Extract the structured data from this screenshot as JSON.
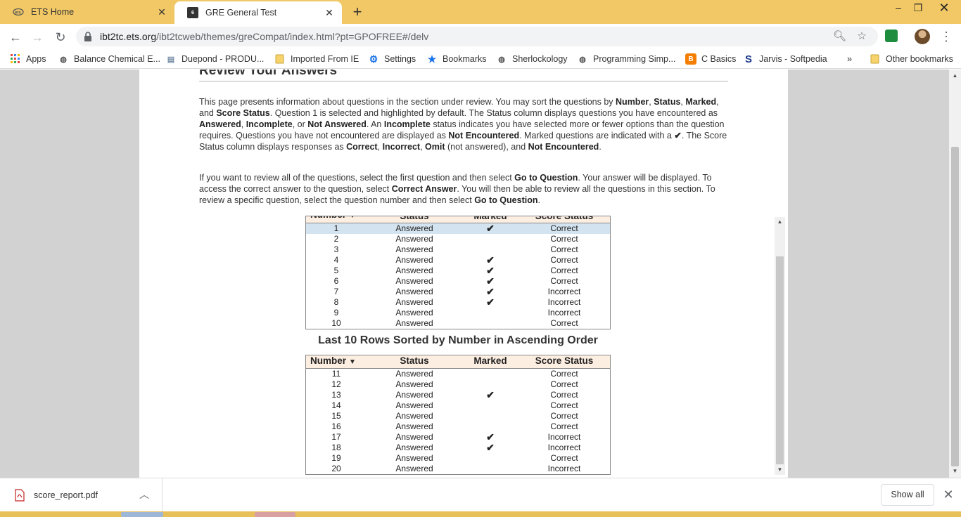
{
  "tabs": [
    {
      "title": "ETS Home",
      "active": false
    },
    {
      "title": "GRE General Test",
      "active": true
    }
  ],
  "address": {
    "url_host": "ibt2tc.ets.org",
    "url_path": "/ibt2tcweb/themes/greCompat/index.html?pt=GPOFREE#/delv"
  },
  "bookmarks": [
    {
      "label": "Apps"
    },
    {
      "label": "Balance Chemical E..."
    },
    {
      "label": "Duepond - PRODU..."
    },
    {
      "label": "Imported From IE"
    },
    {
      "label": "Settings"
    },
    {
      "label": "Bookmarks"
    },
    {
      "label": "Sherlockology"
    },
    {
      "label": "Programming Simp..."
    },
    {
      "label": "C Basics"
    },
    {
      "label": "Jarvis - Softpedia"
    },
    {
      "label": "»"
    },
    {
      "label": "Other bookmarks"
    }
  ],
  "page": {
    "section_title": "Review Your Answers",
    "para1": [
      {
        "t": "This page presents information about questions in the section under review. You may sort the questions by "
      },
      {
        "t": "Number",
        "b": true
      },
      {
        "t": ", "
      },
      {
        "t": "Status",
        "b": true
      },
      {
        "t": ", "
      },
      {
        "t": "Marked",
        "b": true
      },
      {
        "t": ", and "
      },
      {
        "t": "Score Status",
        "b": true
      },
      {
        "t": ". Question 1 is selected and highlighted by default. The Status column displays questions you have encountered as "
      },
      {
        "t": "Answered",
        "b": true
      },
      {
        "t": ", "
      },
      {
        "t": "Incomplete",
        "b": true
      },
      {
        "t": ", or "
      },
      {
        "t": "Not Answered",
        "b": true
      },
      {
        "t": ". An "
      },
      {
        "t": "Incomplete",
        "b": true
      },
      {
        "t": " status indicates you have selected more or fewer options than the question requires. Questions you have not encountered are displayed as "
      },
      {
        "t": "Not Encountered",
        "b": true
      },
      {
        "t": ". Marked questions are indicated with a "
      },
      {
        "t": "✔",
        "b": true
      },
      {
        "t": ". The Score Status column displays responses as "
      },
      {
        "t": "Correct",
        "b": true
      },
      {
        "t": ", "
      },
      {
        "t": "Incorrect",
        "b": true
      },
      {
        "t": ", "
      },
      {
        "t": "Omit",
        "b": true
      },
      {
        "t": " (not answered), and "
      },
      {
        "t": "Not Encountered",
        "b": true
      },
      {
        "t": "."
      }
    ],
    "para2": [
      {
        "t": "If you want to review all of the questions, select the first question and then select "
      },
      {
        "t": "Go to Question",
        "b": true
      },
      {
        "t": ". Your answer will be displayed. To access the correct answer to the question, select "
      },
      {
        "t": "Correct Answer",
        "b": true
      },
      {
        "t": ". You will then be able to review all the questions in this section. To review a specific question, select the question number and then select "
      },
      {
        "t": "Go to Question",
        "b": true
      },
      {
        "t": "."
      }
    ],
    "columns": {
      "number": "Number",
      "status": "Status",
      "marked": "Marked",
      "score": "Score Status"
    },
    "mark_glyph": "✔",
    "table1_rows": [
      {
        "number": "1",
        "status": "Answered",
        "marked": true,
        "score": "Correct",
        "selected": true
      },
      {
        "number": "2",
        "status": "Answered",
        "marked": false,
        "score": "Correct"
      },
      {
        "number": "3",
        "status": "Answered",
        "marked": false,
        "score": "Correct"
      },
      {
        "number": "4",
        "status": "Answered",
        "marked": true,
        "score": "Correct"
      },
      {
        "number": "5",
        "status": "Answered",
        "marked": true,
        "score": "Correct"
      },
      {
        "number": "6",
        "status": "Answered",
        "marked": true,
        "score": "Correct"
      },
      {
        "number": "7",
        "status": "Answered",
        "marked": true,
        "score": "Incorrect"
      },
      {
        "number": "8",
        "status": "Answered",
        "marked": true,
        "score": "Incorrect"
      },
      {
        "number": "9",
        "status": "Answered",
        "marked": false,
        "score": "Incorrect"
      },
      {
        "number": "10",
        "status": "Answered",
        "marked": false,
        "score": "Correct"
      }
    ],
    "table2_caption": "Last 10 Rows Sorted by Number in Ascending Order",
    "table2_rows": [
      {
        "number": "11",
        "status": "Answered",
        "marked": false,
        "score": "Correct"
      },
      {
        "number": "12",
        "status": "Answered",
        "marked": false,
        "score": "Correct"
      },
      {
        "number": "13",
        "status": "Answered",
        "marked": true,
        "score": "Correct"
      },
      {
        "number": "14",
        "status": "Answered",
        "marked": false,
        "score": "Correct"
      },
      {
        "number": "15",
        "status": "Answered",
        "marked": false,
        "score": "Correct"
      },
      {
        "number": "16",
        "status": "Answered",
        "marked": false,
        "score": "Correct"
      },
      {
        "number": "17",
        "status": "Answered",
        "marked": true,
        "score": "Incorrect"
      },
      {
        "number": "18",
        "status": "Answered",
        "marked": true,
        "score": "Incorrect"
      },
      {
        "number": "19",
        "status": "Answered",
        "marked": false,
        "score": "Correct"
      },
      {
        "number": "20",
        "status": "Answered",
        "marked": false,
        "score": "Incorrect"
      }
    ]
  },
  "downloads": {
    "file": "score_report.pdf",
    "show_all": "Show all"
  },
  "colors": {
    "tabstrip": "#f1c865",
    "header_row": "#fdeee2",
    "selected_row": "#d3e3ef",
    "page_bg": "#d2d2d2"
  }
}
